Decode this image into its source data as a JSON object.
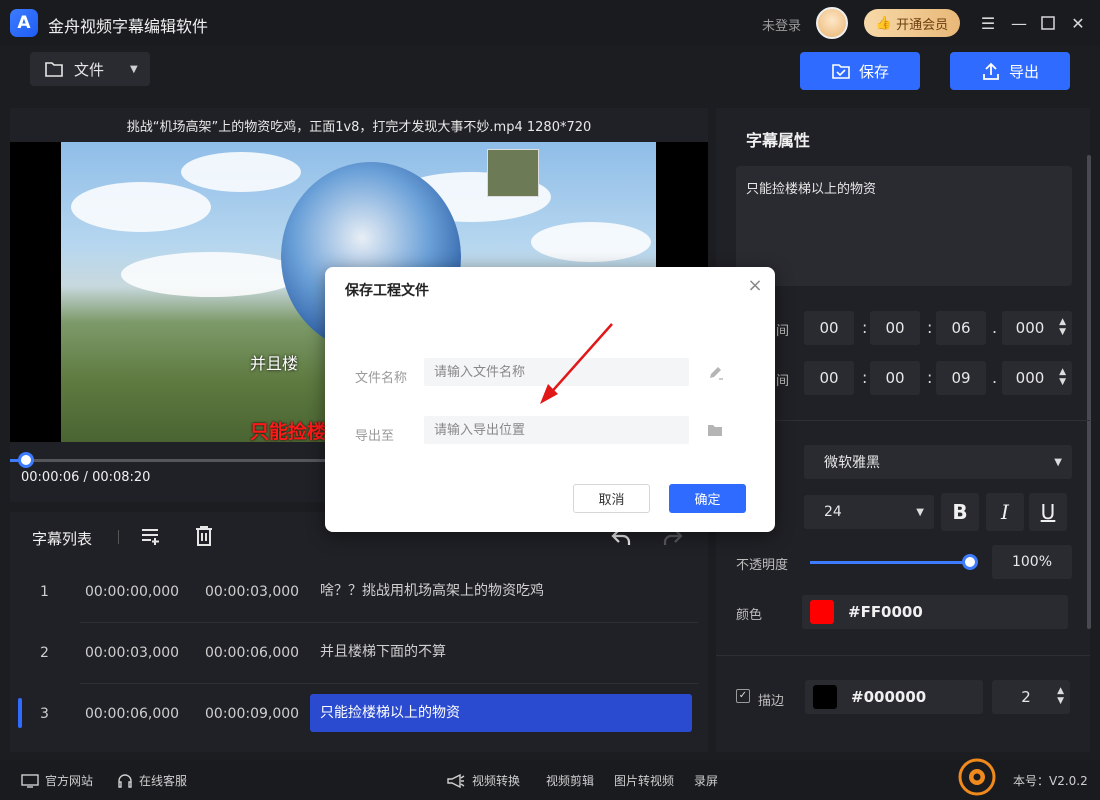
{
  "app": {
    "title": "金舟视频字幕编辑软件",
    "logo_letter": "A",
    "login_status": "未登录",
    "vip_label": "开通会员"
  },
  "toolbar": {
    "file_label": "文件",
    "save_label": "保存",
    "export_label": "导出"
  },
  "video": {
    "title": "挑战“机场高架”上的物资吃鸡，正面1v8，打完才发现大事不妙.mp4   1280*720",
    "overlay_sub_white": "并且楼",
    "overlay_sub_red": "只能捡楼",
    "current_time": "00:00:06",
    "separator": "/",
    "total_time": "00:08:20",
    "progress": 0.012
  },
  "subtitle_list": {
    "title": "字幕列表",
    "rows": [
      {
        "num": "1",
        "start": "00:00:00,000",
        "end": "00:00:03,000",
        "text": "啥？？挑战用机场高架上的物资吃鸡",
        "selected": false
      },
      {
        "num": "2",
        "start": "00:00:03,000",
        "end": "00:00:06,000",
        "text": "并且楼梯下面的不算",
        "selected": false
      },
      {
        "num": "3",
        "start": "00:00:06,000",
        "end": "00:00:09,000",
        "text": "只能捡楼梯以上的物资",
        "selected": true
      }
    ]
  },
  "props": {
    "title": "字幕属性",
    "text": "只能捡楼梯以上的物资",
    "start_label": "间",
    "end_label": "间",
    "start": {
      "h": "00",
      "m": "00",
      "s": "06",
      "ms": "000"
    },
    "end": {
      "h": "00",
      "m": "00",
      "s": "09",
      "ms": "000"
    },
    "font": "微软雅黑",
    "font_size": "24",
    "bold": "B",
    "italic": "I",
    "underline": "U",
    "opacity_label": "不透明度",
    "opacity_value": "100%",
    "opacity": 1.0,
    "color_label": "颜色",
    "color_value": "#FF0000",
    "stroke_label": "描边",
    "stroke_checked": true,
    "stroke_color": "#000000",
    "stroke_width": "2"
  },
  "footer": {
    "website": "官方网站",
    "support": "在线客服",
    "convert": "视频转换",
    "edit": "视频剪辑",
    "img2video": "图片转视频",
    "record": "录屏",
    "version": "本号：V2.0.2"
  },
  "dialog": {
    "title": "保存工程文件",
    "name_label": "文件名称",
    "name_placeholder": "请输入文件名称",
    "path_label": "导出至",
    "path_placeholder": "请输入导出位置",
    "cancel": "取消",
    "ok": "确定"
  },
  "colors": {
    "accent": "#2f6bff",
    "background": "#1c1d21",
    "subtitle_red": "#FF0000"
  }
}
